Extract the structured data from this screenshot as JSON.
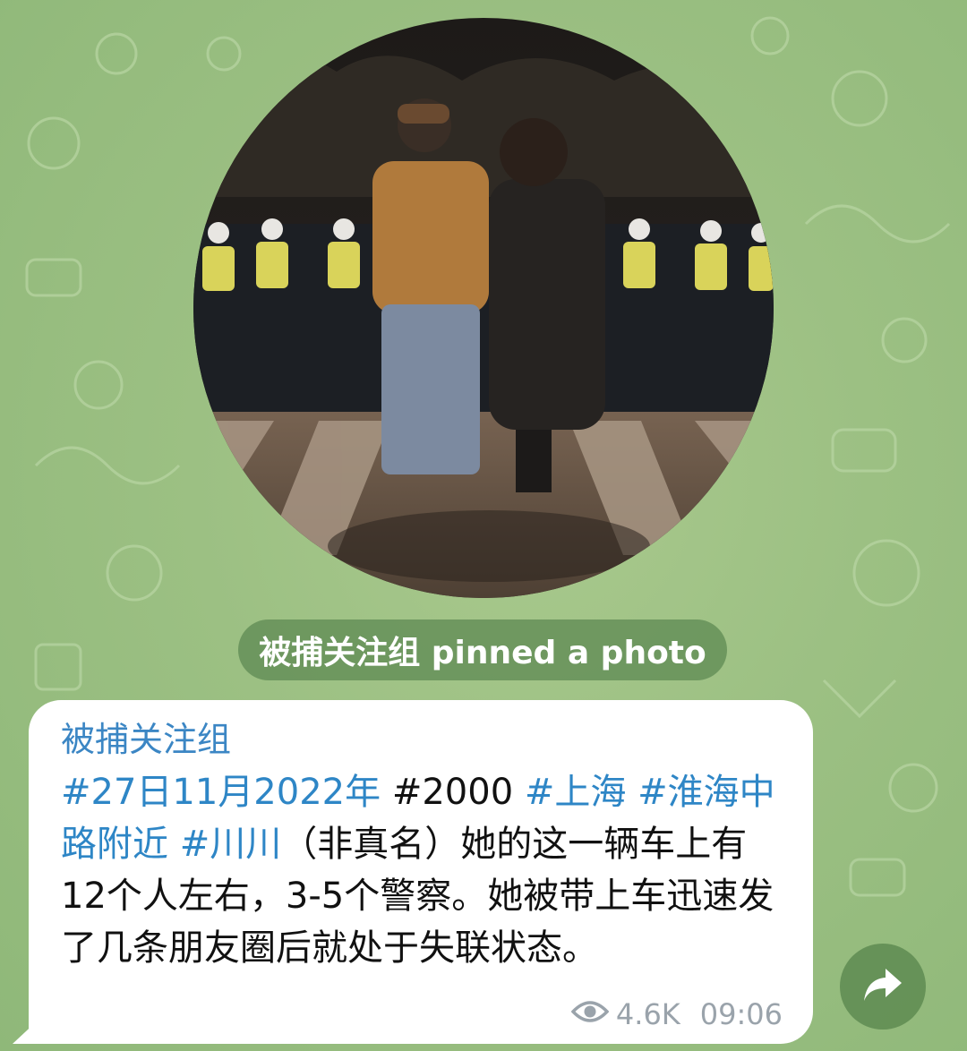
{
  "theme": {
    "accent": "#3b86c4",
    "hashtag": "#2e86c6",
    "wallpaper": "#9cc083",
    "pill": "#608c54"
  },
  "service": {
    "text": "被捕关注组 pinned a photo"
  },
  "message": {
    "sender": "被捕关注组",
    "tags": [
      "#27日11月2022年",
      "#2000",
      "#上海",
      "#淮海中路附近",
      "#川川"
    ],
    "line_parts": [
      {
        "kind": "tag",
        "text": "#27日11月2022年"
      },
      {
        "kind": "text",
        "text": " #2000 "
      },
      {
        "kind": "tag",
        "text": "#上海"
      },
      {
        "kind": "text",
        "text": " "
      },
      {
        "kind": "tag",
        "text": "#淮海中路附近"
      },
      {
        "kind": "text",
        "text": " "
      },
      {
        "kind": "tag",
        "text": "#川川"
      }
    ],
    "body": "（非真名）她的这一辆车上有12个人左右，3-5个警察。她被带上车迅速发了几条朋友圈后就处于失联状态。",
    "views": "4.6K",
    "time": "09:06"
  },
  "icons": {
    "views": "eye-icon",
    "share": "share-arrow-icon"
  }
}
